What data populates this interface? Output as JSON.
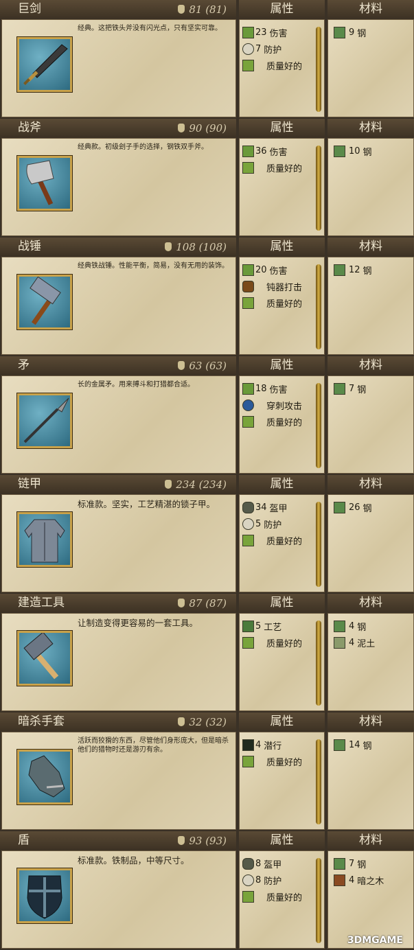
{
  "columns": {
    "attributes": "属性",
    "materials": "材料"
  },
  "items": [
    {
      "name": "巨剑",
      "weight": "81 (81)",
      "desc": "经典。这把铁头斧没有闪光点，只有坚实可靠。",
      "desc_big": false,
      "icon": "greatsword-icon",
      "attributes": [
        {
          "icon": "damage",
          "value": "23",
          "label": "伤害"
        },
        {
          "icon": "defense",
          "value": "7",
          "label": "防护"
        },
        {
          "icon": "quality",
          "value": "",
          "label": "质量好的"
        }
      ],
      "materials": [
        {
          "icon": "steel",
          "value": "9",
          "label": "钢"
        }
      ]
    },
    {
      "name": "战斧",
      "weight": "90 (90)",
      "desc": "经典款。初级刽子手的选择，钢铁双手斧。",
      "desc_big": false,
      "icon": "battleaxe-icon",
      "attributes": [
        {
          "icon": "damage",
          "value": "36",
          "label": "伤害"
        },
        {
          "icon": "quality",
          "value": "",
          "label": "质量好的"
        }
      ],
      "materials": [
        {
          "icon": "steel",
          "value": "10",
          "label": "钢"
        }
      ]
    },
    {
      "name": "战锤",
      "weight": "108 (108)",
      "desc": "经典铁战锤。性能平衡，简易，没有无用的装饰。",
      "desc_big": false,
      "icon": "warhammer-icon",
      "attributes": [
        {
          "icon": "damage",
          "value": "20",
          "label": "伤害"
        },
        {
          "icon": "blunt",
          "value": "",
          "label": "钝器打击"
        },
        {
          "icon": "quality",
          "value": "",
          "label": "质量好的"
        }
      ],
      "materials": [
        {
          "icon": "steel",
          "value": "12",
          "label": "钢"
        }
      ]
    },
    {
      "name": "矛",
      "weight": "63 (63)",
      "desc": "长的金属矛。用来搏斗和打猎都合适。",
      "desc_big": false,
      "icon": "spear-icon",
      "attributes": [
        {
          "icon": "damage",
          "value": "18",
          "label": "伤害"
        },
        {
          "icon": "pierce",
          "value": "",
          "label": "穿刺攻击"
        },
        {
          "icon": "quality",
          "value": "",
          "label": "质量好的"
        }
      ],
      "materials": [
        {
          "icon": "steel",
          "value": "7",
          "label": "钢"
        }
      ]
    },
    {
      "name": "链甲",
      "weight": "234 (234)",
      "desc": "标准款。坚实，工艺精湛的锁子甲。",
      "desc_big": true,
      "icon": "chainmail-icon",
      "attributes": [
        {
          "icon": "armor",
          "value": "34",
          "label": "盔甲"
        },
        {
          "icon": "defense",
          "value": "5",
          "label": "防护"
        },
        {
          "icon": "quality",
          "value": "",
          "label": "质量好的"
        }
      ],
      "materials": [
        {
          "icon": "steel",
          "value": "26",
          "label": "钢"
        }
      ]
    },
    {
      "name": "建造工具",
      "weight": "87 (87)",
      "desc": "让制造变得更容易的一套工具。",
      "desc_big": true,
      "icon": "build-tools-icon",
      "attributes": [
        {
          "icon": "craft",
          "value": "5",
          "label": "工艺"
        },
        {
          "icon": "quality",
          "value": "",
          "label": "质量好的"
        }
      ],
      "materials": [
        {
          "icon": "steel",
          "value": "4",
          "label": "钢"
        },
        {
          "icon": "clay",
          "value": "4",
          "label": "泥土"
        }
      ]
    },
    {
      "name": "暗杀手套",
      "weight": "32 (32)",
      "desc": "活跃而狡猾的东西，尽管他们身形庞大，但是暗杀他们的猎物时还是游刃有余。",
      "desc_big": false,
      "icon": "assassin-gloves-icon",
      "attributes": [
        {
          "icon": "stealth",
          "value": "4",
          "label": "潜行"
        },
        {
          "icon": "quality",
          "value": "",
          "label": "质量好的"
        }
      ],
      "materials": [
        {
          "icon": "steel",
          "value": "14",
          "label": "钢"
        }
      ]
    },
    {
      "name": "盾",
      "weight": "93 (93)",
      "desc": "标准款。铁制品，中等尺寸。",
      "desc_big": true,
      "icon": "shield-icon",
      "attributes": [
        {
          "icon": "armor",
          "value": "8",
          "label": "盔甲"
        },
        {
          "icon": "defense",
          "value": "8",
          "label": "防护"
        },
        {
          "icon": "quality",
          "value": "",
          "label": "质量好的"
        }
      ],
      "materials": [
        {
          "icon": "steel",
          "value": "7",
          "label": "钢"
        },
        {
          "icon": "wood",
          "value": "4",
          "label": "暗之木"
        }
      ]
    }
  ],
  "watermark": "3DMGAME"
}
